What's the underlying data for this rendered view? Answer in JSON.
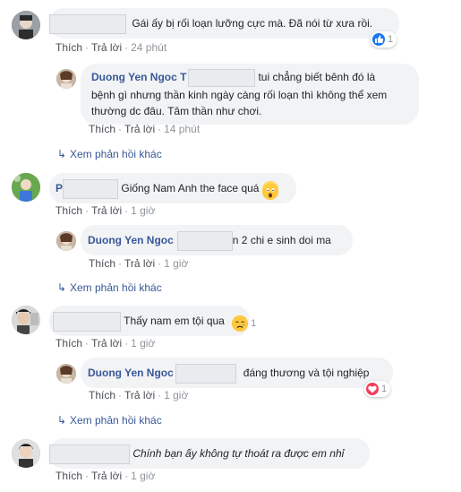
{
  "actions": {
    "like": "Thích",
    "reply": "Trả lời",
    "dot": "·"
  },
  "view_more": "Xem phản hồi khác",
  "reply_author": "Duong Yen Ngoc",
  "c1": {
    "text": "Gái ấy bị rối loạn lưỡng cực mà. Đã nói từ xưa rồi.",
    "time": "24 phút",
    "reaction": {
      "icon": "like-icon",
      "count": "1"
    }
  },
  "c1r": {
    "author": "Duong Yen Ngoc T",
    "line1": "tui chẳng biết bênh đó là",
    "line2": "bệnh gì nhưng thần kinh ngày càng rối loạn thì không thể xem",
    "line3": "thường dc đâu. Tâm thần như chơi.",
    "time": "14 phút"
  },
  "c2": {
    "name_initial": "P",
    "text": "Giống Nam Anh the face quá",
    "emoji": "shocked-emoji-icon",
    "time": "1 giờ"
  },
  "c2r": {
    "text": "n 2 chi e sinh doi ma",
    "time": "1 giờ"
  },
  "c3": {
    "text": "Thấy nam em tội qua",
    "emoji": "sad-tear-emoji-icon",
    "count": "1",
    "time": "1 giờ"
  },
  "c3r": {
    "text": "đáng thương và tội nghiệp",
    "reaction": {
      "icon": "heart-icon",
      "count": "1"
    },
    "time": "1 giờ"
  },
  "c4": {
    "text": "Chính bạn ấy không tự thoát ra được em nhỉ",
    "time": "1 giờ"
  },
  "colors": {
    "link_blue": "#385898",
    "like_blue": "#1877f2",
    "heart_red": "#f33e58",
    "bubble_bg": "#f2f3f5"
  }
}
